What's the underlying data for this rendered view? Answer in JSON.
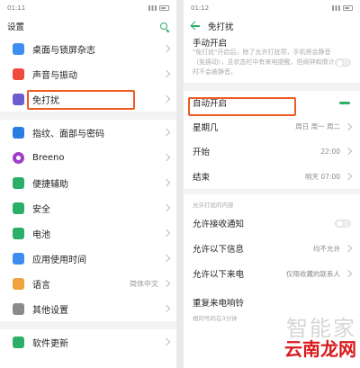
{
  "left": {
    "status": {
      "time": "01:11"
    },
    "appbar": {
      "title": "设置"
    },
    "groups": [
      [
        {
          "label": "桌面与锁屏杂志",
          "icon": "wallpaper-icon",
          "color": "#3d8ef0"
        },
        {
          "label": "声音与振动",
          "icon": "sound-icon",
          "color": "#f0493d"
        },
        {
          "label": "免打扰",
          "icon": "moon-icon",
          "color": "#6b5ccf"
        }
      ],
      [
        {
          "label": "指纹、面部与密码",
          "icon": "fingerprint-icon",
          "color": "#2a7de1"
        },
        {
          "label": "Breeno",
          "icon": "breeno-icon",
          "color": "#a23cc7"
        },
        {
          "label": "便捷辅助",
          "icon": "assist-icon",
          "color": "#2bae68"
        },
        {
          "label": "安全",
          "icon": "shield-icon",
          "color": "#2bae68"
        },
        {
          "label": "电池",
          "icon": "battery-icon",
          "color": "#2bae68"
        },
        {
          "label": "应用使用时间",
          "icon": "hourglass-icon",
          "color": "#3d8ef0"
        },
        {
          "label": "语言",
          "icon": "language-icon",
          "color": "#f0a43d",
          "value": "简体中文"
        },
        {
          "label": "其他设置",
          "icon": "other-icon",
          "color": "#8a8a8a"
        }
      ],
      [
        {
          "label": "软件更新",
          "icon": "update-icon",
          "color": "#2bae68"
        }
      ]
    ]
  },
  "right": {
    "status": {
      "time": "01:12"
    },
    "appbar": {
      "title": "免打扰"
    },
    "manual_label": "手动开启",
    "manual_desc": "\"免打扰\"开启后，除了允许打扰项，手机将会静音（免振动），且状态栏中有来电提醒，但闹钟和倒计时不会被静音。",
    "auto_label": "自动开启",
    "weekday": {
      "label": "星期几",
      "value": "周日 周一 周二"
    },
    "start": {
      "label": "开始",
      "value": "22:00"
    },
    "end": {
      "label": "结束",
      "value": "明天 07:00"
    },
    "section_title": "允许打扰的内容",
    "allow_notif": {
      "label": "允许接收通知"
    },
    "allow_msg": {
      "label": "允许以下信息",
      "value": "均不允许"
    },
    "allow_call": {
      "label": "允许以下来电",
      "value": "仅限收藏的联系人"
    },
    "repeat": {
      "label": "重复来电响铃",
      "desc": "相同号码在3分钟"
    }
  },
  "watermark": {
    "top": "智能家",
    "bottom": "云南龙网"
  },
  "accent": "#2bae68",
  "highlight": "#ef5a24"
}
